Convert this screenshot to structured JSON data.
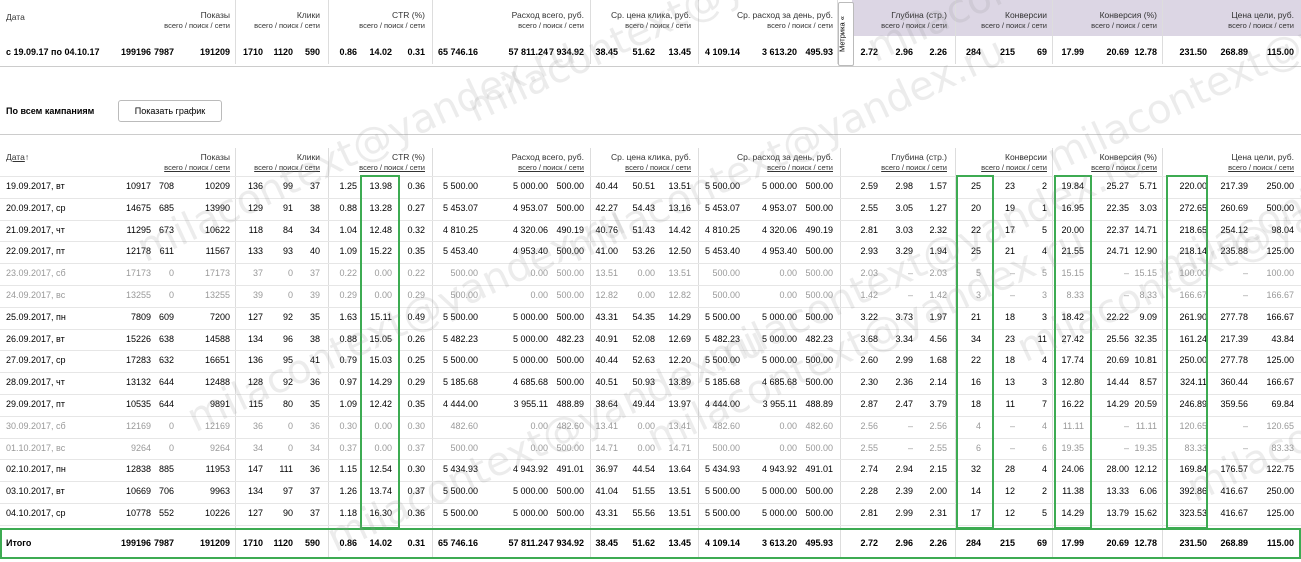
{
  "summary_header": {
    "date_label": "Дата",
    "impressions": "Показы",
    "clicks": "Клики",
    "ctr": "CTR (%)",
    "spend": "Расход всего, руб.",
    "cpc": "Ср. цена клика, руб.",
    "daily_spend": "Ср. расход за день, руб.",
    "metrika_tab": "Метрика «",
    "depth": "Глубина (стр.)",
    "conversions": "Конверсии",
    "conv_rate": "Конверсия (%)",
    "goal_cost": "Цена цели, руб.",
    "sub_vps": "всего / поиск / сети",
    "sub_vps_short": "всего / поиск / сети"
  },
  "summary_row": {
    "period": "с 19.09.17 по 04.10.17",
    "values": [
      "199196",
      "7987",
      "191209",
      "1710",
      "1120",
      "590",
      "0.86",
      "14.02",
      "0.31",
      "65 746.16",
      "57 811.24",
      "7 934.92",
      "38.45",
      "51.62",
      "13.45",
      "4 109.14",
      "3 613.20",
      "495.93",
      "2.72",
      "2.96",
      "2.26",
      "284",
      "215",
      "69",
      "17.99",
      "20.69",
      "12.78",
      "231.50",
      "268.89",
      "115.00"
    ]
  },
  "section": {
    "title": "По всем кампаниям",
    "show_chart_button": "Показать график"
  },
  "table_header": {
    "date": "Дата",
    "sort_arrow": "↑",
    "impressions": "Показы",
    "clicks": "Клики",
    "ctr": "CTR (%)",
    "spend": "Расход всего, руб.",
    "cpc": "Ср. цена клика, руб.",
    "daily_spend": "Ср. расход за день, руб.",
    "depth": "Глубина (стр.)",
    "conversions": "Конверсии",
    "conv_rate": "Конверсия (%)",
    "goal_cost": "Цена цели, руб."
  },
  "rows": [
    {
      "date": "19.09.2017, вт",
      "grey": false,
      "v": [
        "10917",
        "708",
        "10209",
        "136",
        "99",
        "37",
        "1.25",
        "13.98",
        "0.36",
        "5 500.00",
        "5 000.00",
        "500.00",
        "40.44",
        "50.51",
        "13.51",
        "5 500.00",
        "5 000.00",
        "500.00",
        "2.59",
        "2.98",
        "1.57",
        "25",
        "23",
        "2",
        "19.84",
        "25.27",
        "5.71",
        "220.00",
        "217.39",
        "250.00"
      ]
    },
    {
      "date": "20.09.2017, ср",
      "grey": false,
      "v": [
        "14675",
        "685",
        "13990",
        "129",
        "91",
        "38",
        "0.88",
        "13.28",
        "0.27",
        "5 453.07",
        "4 953.07",
        "500.00",
        "42.27",
        "54.43",
        "13.16",
        "5 453.07",
        "4 953.07",
        "500.00",
        "2.55",
        "3.05",
        "1.27",
        "20",
        "19",
        "1",
        "16.95",
        "22.35",
        "3.03",
        "272.65",
        "260.69",
        "500.00"
      ]
    },
    {
      "date": "21.09.2017, чт",
      "grey": false,
      "v": [
        "11295",
        "673",
        "10622",
        "118",
        "84",
        "34",
        "1.04",
        "12.48",
        "0.32",
        "4 810.25",
        "4 320.06",
        "490.19",
        "40.76",
        "51.43",
        "14.42",
        "4 810.25",
        "4 320.06",
        "490.19",
        "2.81",
        "3.03",
        "2.32",
        "22",
        "17",
        "5",
        "20.00",
        "22.37",
        "14.71",
        "218.65",
        "254.12",
        "98.04"
      ]
    },
    {
      "date": "22.09.2017, пт",
      "grey": false,
      "v": [
        "12178",
        "611",
        "11567",
        "133",
        "93",
        "40",
        "1.09",
        "15.22",
        "0.35",
        "5 453.40",
        "4 953.40",
        "500.00",
        "41.00",
        "53.26",
        "12.50",
        "5 453.40",
        "4 953.40",
        "500.00",
        "2.93",
        "3.29",
        "1.94",
        "25",
        "21",
        "4",
        "21.55",
        "24.71",
        "12.90",
        "218.14",
        "235.88",
        "125.00"
      ]
    },
    {
      "date": "23.09.2017, сб",
      "grey": true,
      "v": [
        "17173",
        "0",
        "17173",
        "37",
        "0",
        "37",
        "0.22",
        "0.00",
        "0.22",
        "500.00",
        "0.00",
        "500.00",
        "13.51",
        "0.00",
        "13.51",
        "500.00",
        "0.00",
        "500.00",
        "2.03",
        "–",
        "2.03",
        "5",
        "–",
        "5",
        "15.15",
        "–",
        "15.15",
        "100.00",
        "–",
        "100.00"
      ]
    },
    {
      "date": "24.09.2017, вс",
      "grey": true,
      "v": [
        "13255",
        "0",
        "13255",
        "39",
        "0",
        "39",
        "0.29",
        "0.00",
        "0.29",
        "500.00",
        "0.00",
        "500.00",
        "12.82",
        "0.00",
        "12.82",
        "500.00",
        "0.00",
        "500.00",
        "1.42",
        "–",
        "1.42",
        "3",
        "–",
        "3",
        "8.33",
        "–",
        "8.33",
        "166.67",
        "–",
        "166.67"
      ]
    },
    {
      "date": "25.09.2017, пн",
      "grey": false,
      "v": [
        "7809",
        "609",
        "7200",
        "127",
        "92",
        "35",
        "1.63",
        "15.11",
        "0.49",
        "5 500.00",
        "5 000.00",
        "500.00",
        "43.31",
        "54.35",
        "14.29",
        "5 500.00",
        "5 000.00",
        "500.00",
        "3.22",
        "3.73",
        "1.97",
        "21",
        "18",
        "3",
        "18.42",
        "22.22",
        "9.09",
        "261.90",
        "277.78",
        "166.67"
      ]
    },
    {
      "date": "26.09.2017, вт",
      "grey": false,
      "v": [
        "15226",
        "638",
        "14588",
        "134",
        "96",
        "38",
        "0.88",
        "15.05",
        "0.26",
        "5 482.23",
        "5 000.00",
        "482.23",
        "40.91",
        "52.08",
        "12.69",
        "5 482.23",
        "5 000.00",
        "482.23",
        "3.68",
        "3.34",
        "4.56",
        "34",
        "23",
        "11",
        "27.42",
        "25.56",
        "32.35",
        "161.24",
        "217.39",
        "43.84"
      ]
    },
    {
      "date": "27.09.2017, ср",
      "grey": false,
      "v": [
        "17283",
        "632",
        "16651",
        "136",
        "95",
        "41",
        "0.79",
        "15.03",
        "0.25",
        "5 500.00",
        "5 000.00",
        "500.00",
        "40.44",
        "52.63",
        "12.20",
        "5 500.00",
        "5 000.00",
        "500.00",
        "2.60",
        "2.99",
        "1.68",
        "22",
        "18",
        "4",
        "17.74",
        "20.69",
        "10.81",
        "250.00",
        "277.78",
        "125.00"
      ]
    },
    {
      "date": "28.09.2017, чт",
      "grey": false,
      "v": [
        "13132",
        "644",
        "12488",
        "128",
        "92",
        "36",
        "0.97",
        "14.29",
        "0.29",
        "5 185.68",
        "4 685.68",
        "500.00",
        "40.51",
        "50.93",
        "13.89",
        "5 185.68",
        "4 685.68",
        "500.00",
        "2.30",
        "2.36",
        "2.14",
        "16",
        "13",
        "3",
        "12.80",
        "14.44",
        "8.57",
        "324.11",
        "360.44",
        "166.67"
      ]
    },
    {
      "date": "29.09.2017, пт",
      "grey": false,
      "v": [
        "10535",
        "644",
        "9891",
        "115",
        "80",
        "35",
        "1.09",
        "12.42",
        "0.35",
        "4 444.00",
        "3 955.11",
        "488.89",
        "38.64",
        "49.44",
        "13.97",
        "4 444.00",
        "3 955.11",
        "488.89",
        "2.87",
        "2.47",
        "3.79",
        "18",
        "11",
        "7",
        "16.22",
        "14.29",
        "20.59",
        "246.89",
        "359.56",
        "69.84"
      ]
    },
    {
      "date": "30.09.2017, сб",
      "grey": true,
      "v": [
        "12169",
        "0",
        "12169",
        "36",
        "0",
        "36",
        "0.30",
        "0.00",
        "0.30",
        "482.60",
        "0.00",
        "482.60",
        "13.41",
        "0.00",
        "13.41",
        "482.60",
        "0.00",
        "482.60",
        "2.56",
        "–",
        "2.56",
        "4",
        "–",
        "4",
        "11.11",
        "–",
        "11.11",
        "120.65",
        "–",
        "120.65"
      ]
    },
    {
      "date": "01.10.2017, вс",
      "grey": true,
      "v": [
        "9264",
        "0",
        "9264",
        "34",
        "0",
        "34",
        "0.37",
        "0.00",
        "0.37",
        "500.00",
        "0.00",
        "500.00",
        "14.71",
        "0.00",
        "14.71",
        "500.00",
        "0.00",
        "500.00",
        "2.55",
        "–",
        "2.55",
        "6",
        "–",
        "6",
        "19.35",
        "–",
        "19.35",
        "83.33",
        "–",
        "83.33"
      ]
    },
    {
      "date": "02.10.2017, пн",
      "grey": false,
      "v": [
        "12838",
        "885",
        "11953",
        "147",
        "111",
        "36",
        "1.15",
        "12.54",
        "0.30",
        "5 434.93",
        "4 943.92",
        "491.01",
        "36.97",
        "44.54",
        "13.64",
        "5 434.93",
        "4 943.92",
        "491.01",
        "2.74",
        "2.94",
        "2.15",
        "32",
        "28",
        "4",
        "24.06",
        "28.00",
        "12.12",
        "169.84",
        "176.57",
        "122.75"
      ]
    },
    {
      "date": "03.10.2017, вт",
      "grey": false,
      "v": [
        "10669",
        "706",
        "9963",
        "134",
        "97",
        "37",
        "1.26",
        "13.74",
        "0.37",
        "5 500.00",
        "5 000.00",
        "500.00",
        "41.04",
        "51.55",
        "13.51",
        "5 500.00",
        "5 000.00",
        "500.00",
        "2.28",
        "2.39",
        "2.00",
        "14",
        "12",
        "2",
        "11.38",
        "13.33",
        "6.06",
        "392.86",
        "416.67",
        "250.00"
      ]
    },
    {
      "date": "04.10.2017, ср",
      "grey": false,
      "v": [
        "10778",
        "552",
        "10226",
        "127",
        "90",
        "37",
        "1.18",
        "16.30",
        "0.36",
        "5 500.00",
        "5 000.00",
        "500.00",
        "43.31",
        "55.56",
        "13.51",
        "5 500.00",
        "5 000.00",
        "500.00",
        "2.81",
        "2.99",
        "2.31",
        "17",
        "12",
        "5",
        "14.29",
        "13.79",
        "15.62",
        "323.53",
        "416.67",
        "125.00"
      ]
    }
  ],
  "total_row": {
    "label": "Итого",
    "values": [
      "199196",
      "7987",
      "191209",
      "1710",
      "1120",
      "590",
      "0.86",
      "14.02",
      "0.31",
      "65 746.16",
      "57 811.24",
      "7 934.92",
      "38.45",
      "51.62",
      "13.45",
      "4 109.14",
      "3 613.20",
      "495.93",
      "2.72",
      "2.96",
      "2.26",
      "284",
      "215",
      "69",
      "17.99",
      "20.69",
      "12.78",
      "231.50",
      "268.89",
      "115.00"
    ]
  },
  "watermark": "milacontext@yandex.ru",
  "colors": {
    "highlight": "#3dab52",
    "metrika_bg": "#dcd6e4",
    "grey_text": "#999999"
  }
}
